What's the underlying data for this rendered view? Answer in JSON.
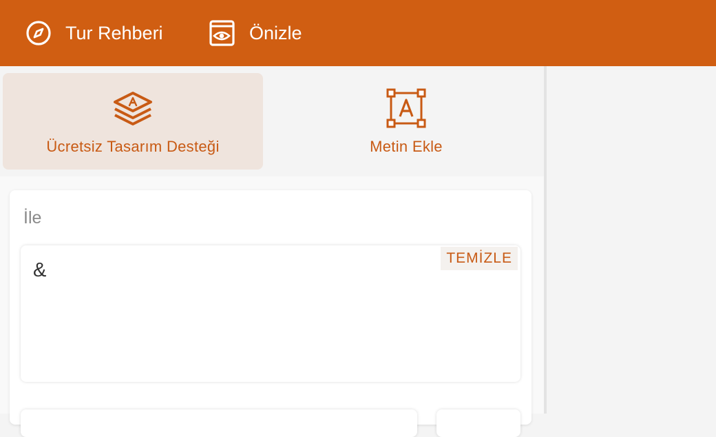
{
  "header": {
    "tour_label": "Tur Rehberi",
    "tour_icon": "compass-icon",
    "preview_label": "Önizle",
    "preview_icon": "eye-icon"
  },
  "tabs": [
    {
      "label": "Ücretsiz Tasarım Desteği",
      "icon": "layers-text-icon",
      "active": true
    },
    {
      "label": "Metin Ekle",
      "icon": "text-box-icon",
      "active": false
    }
  ],
  "editor": {
    "title": "İle",
    "value": "&",
    "clear_label": "TEMİZLE"
  },
  "colors": {
    "brand": "#d05e12",
    "accent_text": "#c85a14",
    "active_tab_bg": "#efe4dd"
  }
}
